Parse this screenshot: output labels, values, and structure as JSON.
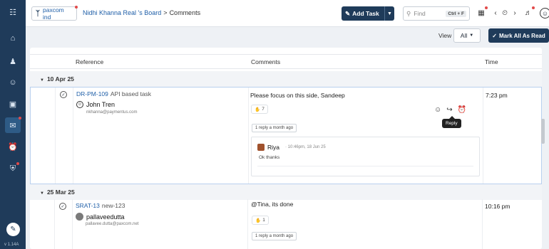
{
  "rail": {
    "icons": [
      "grid-icon",
      "home-icon",
      "users-icon",
      "team-icon",
      "book-icon",
      "comments-icon",
      "alarm-icon",
      "shield-icon"
    ],
    "version": "v 1.14A"
  },
  "topbar": {
    "workspace": "paxcom ind",
    "breadcrumb_board": "Nidhi Khanna Real 's Board",
    "breadcrumb_sep": ">",
    "breadcrumb_current": "Comments",
    "add_task": "Add Task",
    "find_placeholder": "Find",
    "find_shortcut": "Ctrl + F"
  },
  "viewbar": {
    "view_label": "View",
    "view_value": "All",
    "mark_all_read": "Mark All As Read"
  },
  "table": {
    "headers": {
      "reference": "Reference",
      "comments": "Comments",
      "time": "Time"
    },
    "groups": [
      {
        "date": "10 Apr 25",
        "row": {
          "task_id": "DR-PM-109",
          "task_title": "API based task",
          "user_name": "John Tren",
          "user_email": "nkhanna@paymentus.com",
          "comment": "Please focus on this side, Sandeep",
          "reaction_count": "7",
          "replies_label": "1 reply a month ago",
          "time": "7:23 pm",
          "reply_tooltip": "Reply",
          "reply": {
            "name": "Riya",
            "time": "· 10:46pm, 18 Jun 25",
            "text": "Ok thanks"
          }
        }
      },
      {
        "date": "25 Mar 25",
        "row": {
          "task_id": "SRAT-13",
          "task_title": "new-123",
          "user_name": "pallaveedutta",
          "user_email": "pallavee.dutta@paxcom.net",
          "comment": "@Tina, its done",
          "reaction_count": "1",
          "replies_label": "1 reply a month ago",
          "time": "10:16 pm"
        }
      }
    ]
  },
  "colors": {
    "navy": "#1f3b5a",
    "link": "#1f5fa8",
    "badge": "#e24a4a"
  }
}
